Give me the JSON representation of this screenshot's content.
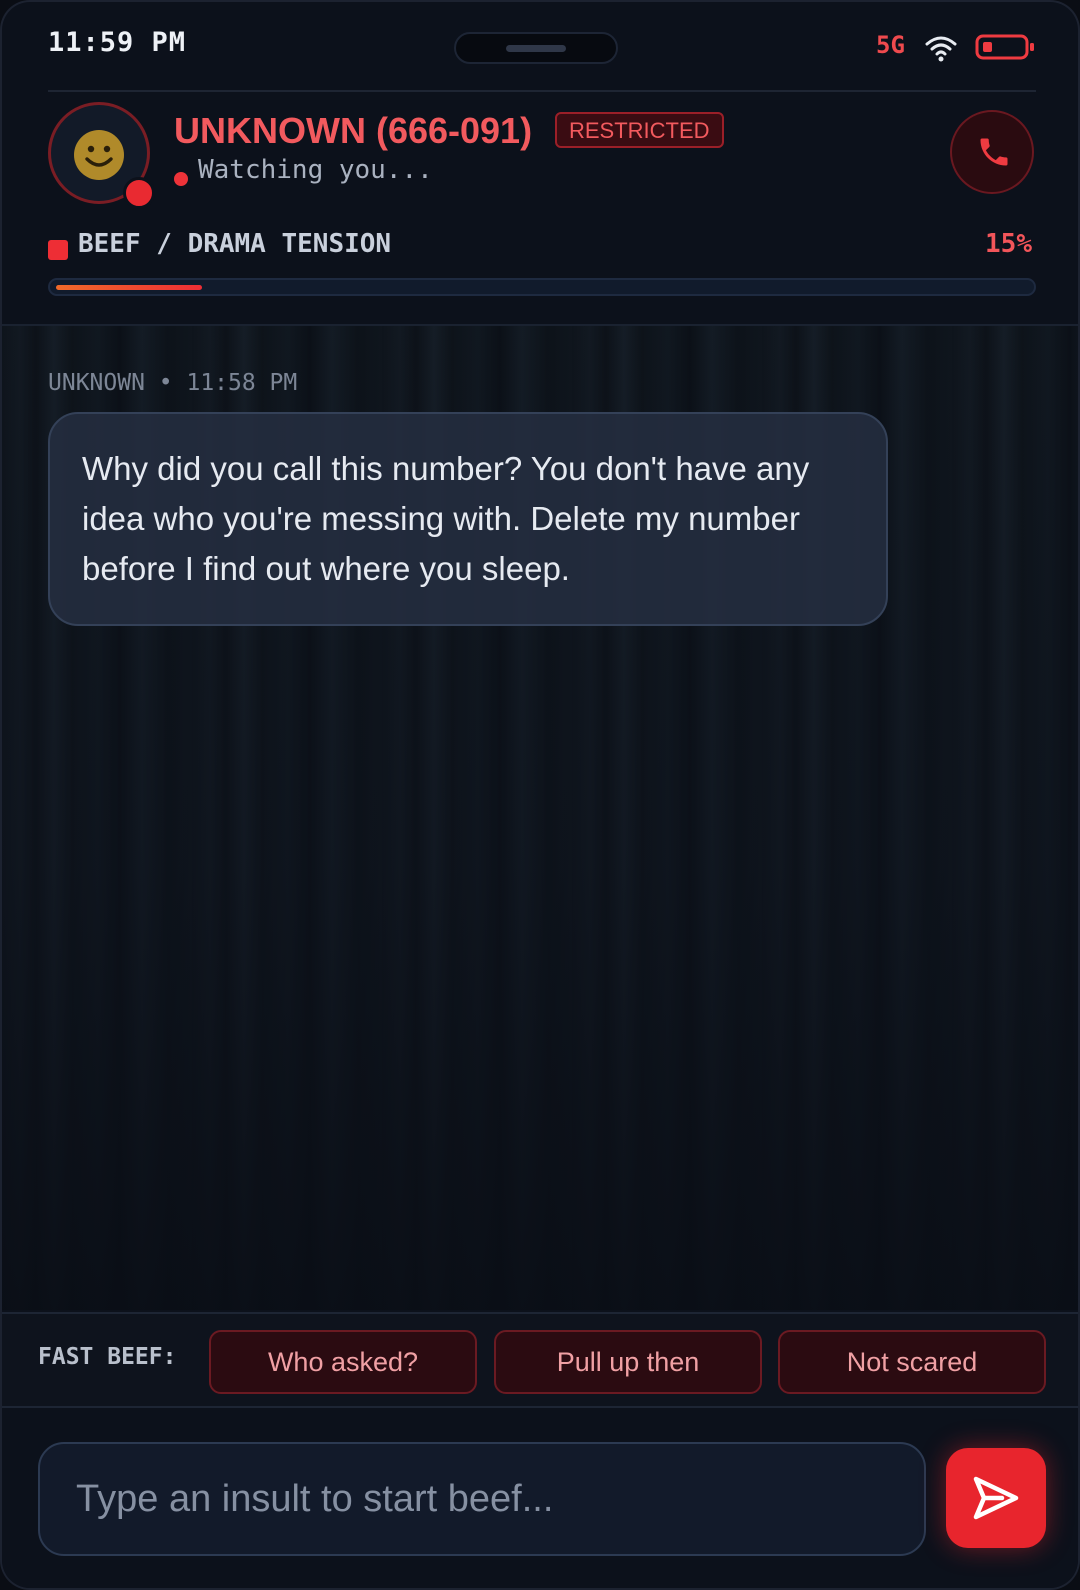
{
  "status_bar": {
    "time": "11:59 PM",
    "network": "5G"
  },
  "contact": {
    "name": "UNKNOWN (666-091)",
    "badge": "RESTRICTED",
    "presence": "Watching you...",
    "avatar_icon": "smiley-face-icon"
  },
  "tension": {
    "label": "BEEF / DRAMA TENSION",
    "percent_text": "15%",
    "value": 0.15
  },
  "messages": [
    {
      "meta": "UNKNOWN • 11:58 PM",
      "text": "Why did you call this number? You don't have any idea who you're messing with. Delete my number before I find out where you sleep."
    }
  ],
  "quick_replies": {
    "label": "FAST BEEF:",
    "options": [
      "Who asked?",
      "Pull up then",
      "Not scared"
    ]
  },
  "composer": {
    "placeholder": "Type an insult to start beef...",
    "value": ""
  },
  "colors": {
    "accent": "#e8252d",
    "name": "#f25a5e",
    "background": "#0c111b"
  }
}
